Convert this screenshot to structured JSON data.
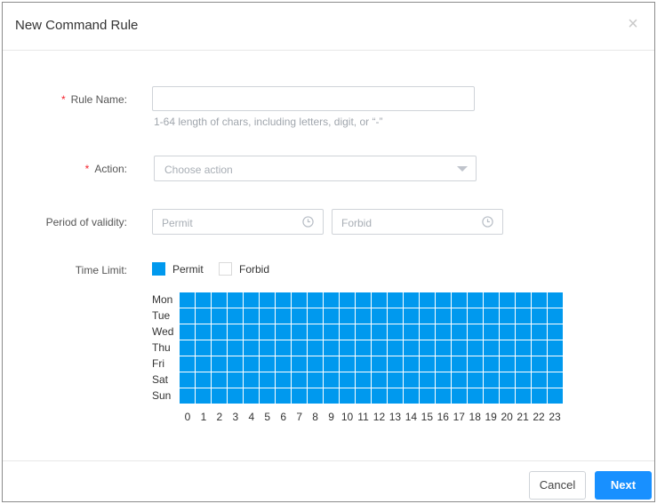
{
  "dialog": {
    "title": "New Command Rule",
    "close_symbol": "×"
  },
  "form": {
    "rule_name": {
      "label": "Rule Name:",
      "value": "",
      "placeholder": "",
      "hint": "1-64 length of chars, including letters, digit, or “-”"
    },
    "action": {
      "label": "Action:",
      "placeholder": "Choose action"
    },
    "validity": {
      "label": "Period of validity:",
      "permit_placeholder": "Permit",
      "forbid_placeholder": "Forbid"
    },
    "time_limit": {
      "label": "Time Limit:",
      "legend_permit": "Permit",
      "legend_forbid": "Forbid",
      "permit_color": "#0099ee",
      "forbid_color": "#ffffff",
      "days": [
        "Mon",
        "Tue",
        "Wed",
        "Thu",
        "Fri",
        "Sat",
        "Sun"
      ],
      "hours": [
        "0",
        "1",
        "2",
        "3",
        "4",
        "5",
        "6",
        "7",
        "8",
        "9",
        "10",
        "11",
        "12",
        "13",
        "14",
        "15",
        "16",
        "17",
        "18",
        "19",
        "20",
        "21",
        "22",
        "23"
      ],
      "all_permitted": true
    }
  },
  "footer": {
    "cancel_label": "Cancel",
    "next_label": "Next"
  }
}
